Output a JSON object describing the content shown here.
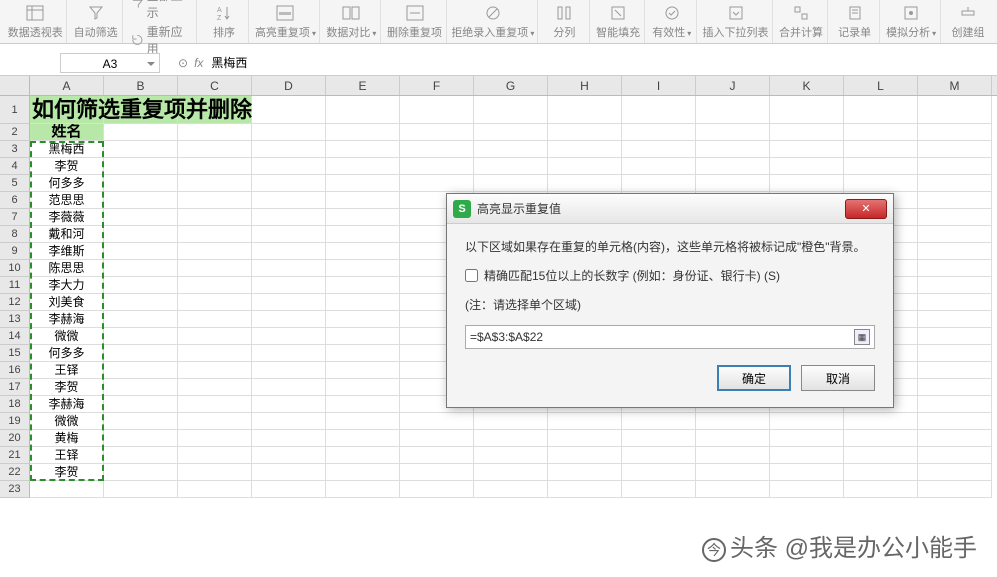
{
  "ribbon": [
    {
      "label": "数据透视表",
      "icon": "pivot"
    },
    {
      "label": "自动筛选",
      "icon": "filter"
    },
    {
      "label": "全部显示",
      "icon": "showall",
      "inline": true
    },
    {
      "label": "重新应用",
      "icon": "reapply",
      "inline": true
    },
    {
      "label": "排序",
      "icon": "sort"
    },
    {
      "label": "高亮重复项",
      "icon": "highlight-dup",
      "dropdown": true
    },
    {
      "label": "数据对比",
      "icon": "compare",
      "dropdown": true
    },
    {
      "label": "删除重复项",
      "icon": "remove-dup"
    },
    {
      "label": "拒绝录入重复项",
      "icon": "reject-dup",
      "dropdown": true
    },
    {
      "label": "分列",
      "icon": "split"
    },
    {
      "label": "智能填充",
      "icon": "fill"
    },
    {
      "label": "有效性",
      "icon": "validity",
      "dropdown": true
    },
    {
      "label": "插入下拉列表",
      "icon": "dropdown-list"
    },
    {
      "label": "合并计算",
      "icon": "merge-calc"
    },
    {
      "label": "记录单",
      "icon": "record"
    },
    {
      "label": "模拟分析",
      "icon": "simulate",
      "dropdown": true
    },
    {
      "label": "创建组",
      "icon": "group"
    }
  ],
  "name_box": "A3",
  "fx_symbol": "fx",
  "formula_value": "黑梅西",
  "columns": [
    "A",
    "B",
    "C",
    "D",
    "E",
    "F",
    "G",
    "H",
    "I",
    "J",
    "K",
    "L",
    "M"
  ],
  "rows": [
    {
      "n": 1,
      "a": "如何筛选重复项并删除",
      "tall": true,
      "title": true,
      "hl": true
    },
    {
      "n": 2,
      "a": "姓名",
      "header": true,
      "hl": true
    },
    {
      "n": 3,
      "a": "黑梅西"
    },
    {
      "n": 4,
      "a": "李贺"
    },
    {
      "n": 5,
      "a": "何多多"
    },
    {
      "n": 6,
      "a": "范思思"
    },
    {
      "n": 7,
      "a": "李薇薇"
    },
    {
      "n": 8,
      "a": "戴和河"
    },
    {
      "n": 9,
      "a": "李维斯"
    },
    {
      "n": 10,
      "a": "陈思思"
    },
    {
      "n": 11,
      "a": "李大力"
    },
    {
      "n": 12,
      "a": "刘美食"
    },
    {
      "n": 13,
      "a": "李赫海"
    },
    {
      "n": 14,
      "a": "微微"
    },
    {
      "n": 15,
      "a": "何多多"
    },
    {
      "n": 16,
      "a": "王铎"
    },
    {
      "n": 17,
      "a": "李贺"
    },
    {
      "n": 18,
      "a": "李赫海"
    },
    {
      "n": 19,
      "a": "微微"
    },
    {
      "n": 20,
      "a": "黄梅"
    },
    {
      "n": 21,
      "a": "王铎"
    },
    {
      "n": 22,
      "a": "李贺"
    },
    {
      "n": 23,
      "a": ""
    }
  ],
  "dialog": {
    "title": "高亮显示重复值",
    "desc": "以下区域如果存在重复的单元格(内容)，这些单元格将被标记成\"橙色\"背景。",
    "checkbox_label": "精确匹配15位以上的长数字 (例如：身份证、银行卡) (S)",
    "note": "(注：请选择单个区域)",
    "range_value": "=$A$3:$A$22",
    "ok": "确定",
    "cancel": "取消"
  },
  "watermark": "头条 @我是办公小能手"
}
